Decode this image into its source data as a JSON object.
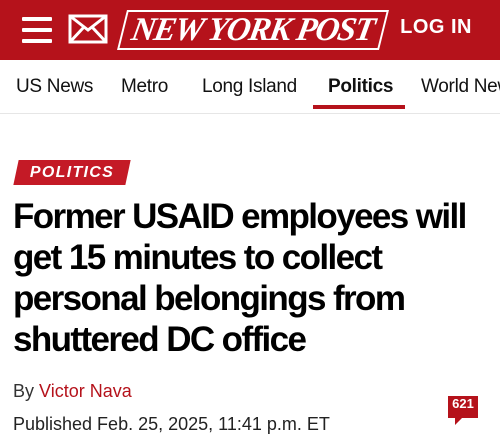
{
  "header": {
    "logo_text": "NEW YORK POST",
    "login_label": "LOG IN",
    "brand_color": "#b5121b",
    "menu_icon": "hamburger-menu-icon",
    "mail_icon": "envelope-icon"
  },
  "nav": {
    "items": [
      {
        "label": "US News"
      },
      {
        "label": "Metro"
      },
      {
        "label": "Long Island"
      },
      {
        "label": "Politics",
        "active": true
      },
      {
        "label": "World New"
      }
    ]
  },
  "article": {
    "kicker": "POLITICS",
    "headline": "Former USAID employees will get 15 minutes to collect personal belongings from shuttered DC office",
    "byline_prefix": "By ",
    "author": "Victor Nava",
    "published": "Published Feb. 25, 2025, 11:41 p.m. ET",
    "comment_count": "621"
  }
}
